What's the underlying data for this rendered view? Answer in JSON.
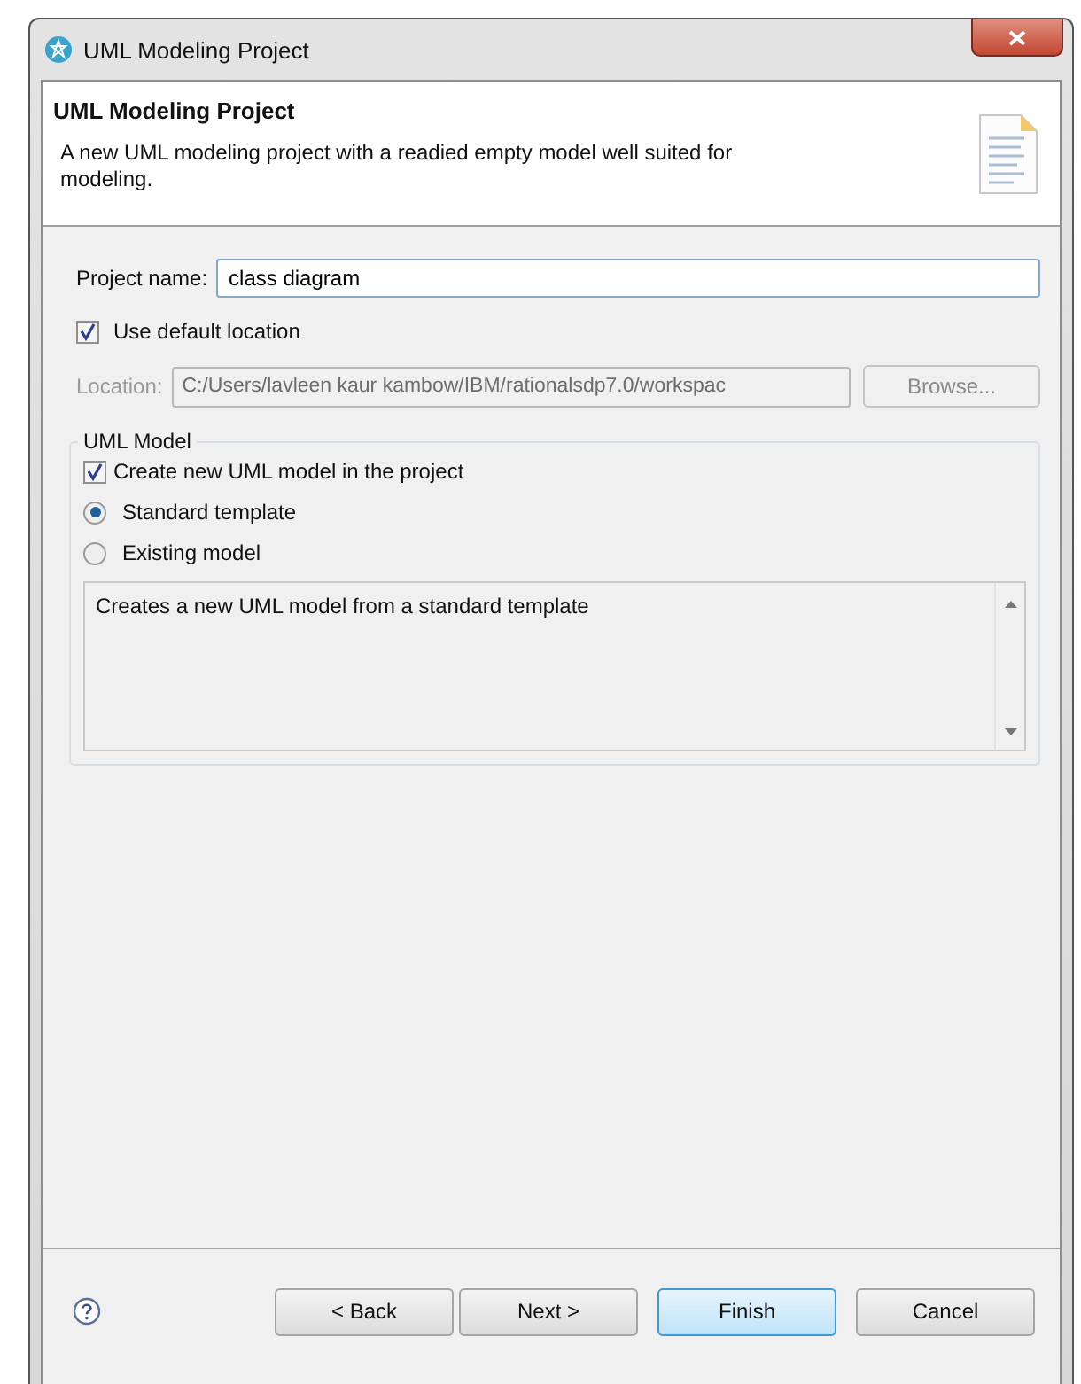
{
  "window": {
    "title": "UML Modeling Project"
  },
  "header": {
    "title": "UML Modeling Project",
    "description": "A new UML modeling project with a readied empty model well suited for modeling."
  },
  "project_name": {
    "label": "Project name:",
    "value": "class diagram"
  },
  "use_default_location": {
    "label": "Use default location",
    "checked": true
  },
  "location": {
    "label": "Location:",
    "value": "C:/Users/lavleen kaur kambow/IBM/rationalsdp7.0/workspac",
    "disabled": true,
    "browse": {
      "label": "Browse...",
      "disabled": true
    }
  },
  "uml_model": {
    "title": "UML Model",
    "create_model": {
      "label": "Create new UML model in the project",
      "checked": true
    },
    "options": [
      {
        "label": "Standard template",
        "selected": true
      },
      {
        "label": "Existing model",
        "selected": false
      }
    ],
    "description": "Creates a new UML model from a standard template"
  },
  "buttons": [
    {
      "label": "< Back",
      "default": false
    },
    {
      "label": "Next >",
      "default": false
    },
    {
      "label": "Finish",
      "default": true
    },
    {
      "label": "Cancel",
      "default": false
    }
  ]
}
